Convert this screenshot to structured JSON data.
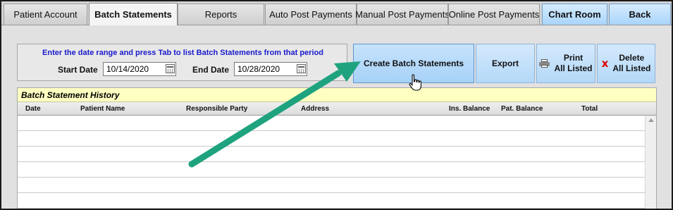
{
  "tabs": [
    {
      "label": "Patient Account"
    },
    {
      "label": "Batch Statements"
    },
    {
      "label": "Reports"
    },
    {
      "label": "Auto Post Payments"
    },
    {
      "label": "Manual Post Payments"
    },
    {
      "label": "Online Post Payments"
    },
    {
      "label": "Chart Room"
    },
    {
      "label": "Back"
    }
  ],
  "active_tab": "Batch Statements",
  "range": {
    "hint": "Enter the date range and press Tab to list Batch Statements from that period",
    "start_label": "Start Date",
    "start_value": "10/14/2020",
    "end_label": "End Date",
    "end_value": "10/28/2020"
  },
  "buttons": {
    "create": "Create Batch Statements",
    "export": "Export",
    "print_line1": "Print",
    "print_line2": "All Listed",
    "delete_line1": "Delete",
    "delete_line2": "All Listed"
  },
  "grid": {
    "title": "Batch Statement History",
    "columns": [
      "Date",
      "Patient Name",
      "Responsible Party",
      "Address",
      "Ins. Balance",
      "Pat. Balance",
      "Total"
    ]
  },
  "icons": {
    "print": "printer-icon",
    "delete": "red-x-icon",
    "calendar": "calendar-icon",
    "cursor": "hand-pointer-icon",
    "annotation": "green-arrow"
  },
  "colors": {
    "tab_blue": "#a9d4fb",
    "button_blue": "#b3d8f8",
    "grid_title_bg": "#ffffc2",
    "hint_text": "#1a1acc",
    "annotation_arrow": "#1fa37f",
    "delete_x": "#e00000"
  }
}
